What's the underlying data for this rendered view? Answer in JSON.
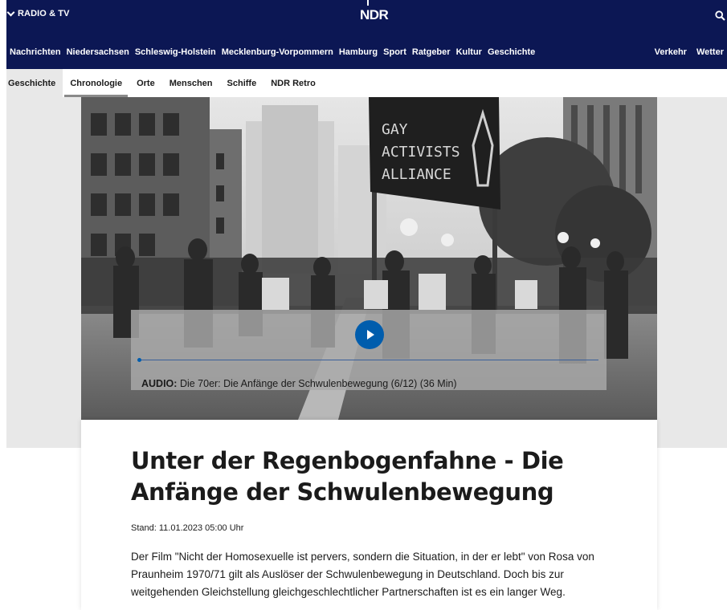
{
  "topbar": {
    "radio_tv": "RADIO & TV",
    "logo": "NDR"
  },
  "main_nav": {
    "items": [
      "Nachrichten",
      "Niedersachsen",
      "Schleswig-Holstein",
      "Mecklenburg-Vorpommern",
      "Hamburg",
      "Sport",
      "Ratgeber",
      "Kultur",
      "Geschichte"
    ],
    "right_items": [
      "Verkehr",
      "Wetter"
    ]
  },
  "sub_nav": {
    "current": "Geschichte",
    "items": [
      "Chronologie",
      "Orte",
      "Menschen",
      "Schiffe",
      "NDR Retro"
    ],
    "active_index": 0
  },
  "hero": {
    "banner_lines": [
      "GAY",
      "ACTIVISTS",
      "ALLIANCE"
    ]
  },
  "audio": {
    "prefix": "AUDIO:",
    "title": "Die 70er: Die Anfänge der Schwulenbewegung (6/12) (36 Min)",
    "progress": 0
  },
  "article": {
    "headline": "Unter der Regenbogenfahne - Die Anfänge der Schwulenbewegung",
    "stand": "Stand: 11.01.2023 05:00 Uhr",
    "teaser": "Der Film \"Nicht der Homosexuelle ist pervers, sondern die Situation, in der er lebt\" von Rosa von Praunheim 1970/71 gilt als Auslöser der Schwulenbewegung in Deutschland. Doch bis zur weitgehenden Gleichstellung gleichgeschlechtlicher Partnerschaften ist es ein langer Weg."
  },
  "colors": {
    "brand_navy": "#0c1754",
    "play_blue": "#005dad",
    "gray_band": "#e8e8e8"
  },
  "icons": [
    "chevron-down-icon",
    "search-icon",
    "play-icon"
  ]
}
